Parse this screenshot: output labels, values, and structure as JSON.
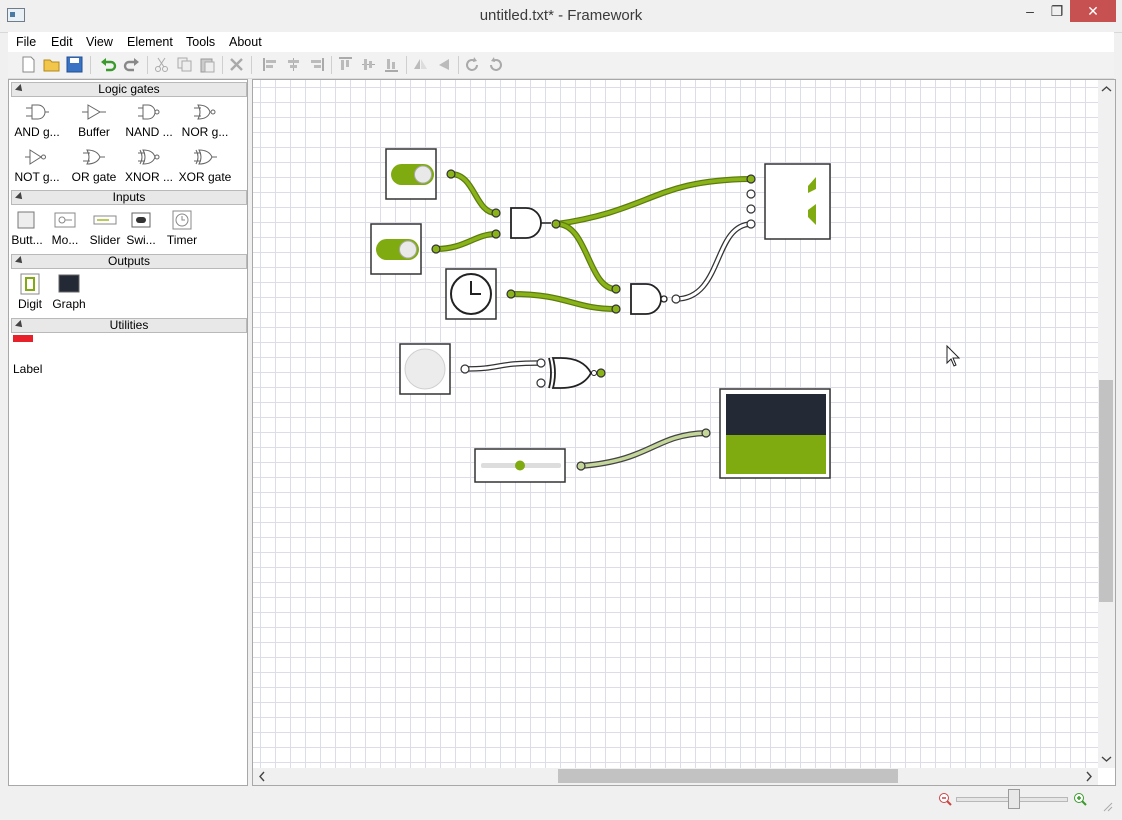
{
  "window": {
    "title": "untitled.txt* - Framework",
    "controls": {
      "minimize": "‒",
      "maximize": "❐",
      "close": "✕"
    }
  },
  "menu": [
    "File",
    "Edit",
    "View",
    "Element",
    "Tools",
    "About"
  ],
  "toolbar": {
    "icons": [
      "new-file-icon",
      "open-folder-icon",
      "save-icon",
      "undo-icon",
      "redo-icon",
      "cut-icon",
      "copy-icon",
      "paste-icon",
      "delete-icon",
      "align-left-icon",
      "align-center-icon",
      "align-right-icon",
      "align-top-icon",
      "align-middle-icon",
      "align-bottom-icon",
      "flip-horizontal-icon",
      "flip-vertical-icon",
      "rotate-left-icon",
      "rotate-right-icon"
    ]
  },
  "sidebar": {
    "sections": [
      {
        "title": "Logic gates",
        "items": [
          "AND g...",
          "Buffer",
          "NAND ...",
          "NOR g...",
          "NOT g...",
          "OR gate",
          "XNOR ...",
          "XOR gate"
        ]
      },
      {
        "title": "Inputs",
        "items": [
          "Butt...",
          "Mo...",
          "Slider",
          "Swi...",
          "Timer"
        ]
      },
      {
        "title": "Outputs",
        "items": [
          "Digit",
          "Graph"
        ]
      },
      {
        "title": "Utilities",
        "items": [
          "Label"
        ]
      }
    ]
  },
  "canvas": {
    "grid": true,
    "components": [
      {
        "type": "switch",
        "state": "on"
      },
      {
        "type": "switch",
        "state": "on"
      },
      {
        "type": "clock"
      },
      {
        "type": "button",
        "state": "off"
      },
      {
        "type": "slider",
        "level": 0.5
      },
      {
        "type": "and-gate"
      },
      {
        "type": "nand-gate"
      },
      {
        "type": "xor-gate"
      },
      {
        "type": "digit-display"
      },
      {
        "type": "graph-display",
        "fill_level": 0.5
      }
    ]
  },
  "colors": {
    "wire_active": "#8ab31a",
    "wire_active_dark": "#5c7d0d",
    "wire_inactive": "#ffffff",
    "slider_wire": "#c4d69a",
    "graph_background": "#232a35",
    "graph_fill": "#7fab10",
    "close_button": "#c75050"
  },
  "statusbar": {
    "zoom": {
      "out_icon": "zoom-out-icon",
      "in_icon": "zoom-in-icon"
    }
  }
}
